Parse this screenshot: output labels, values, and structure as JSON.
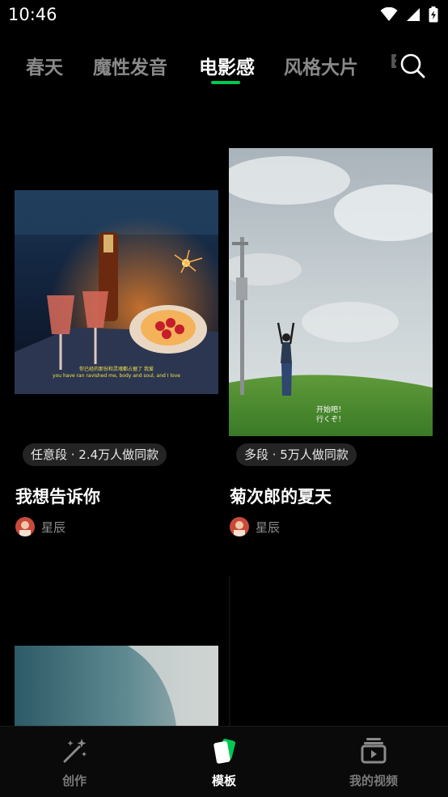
{
  "status": {
    "time": "10:46"
  },
  "tabs": [
    {
      "label": "春天"
    },
    {
      "label": "魔性发音"
    },
    {
      "label": "电影感"
    },
    {
      "label": "风格大片"
    }
  ],
  "active_tab": "电影感",
  "cards": [
    {
      "badge": "任意段 · 2.4万人做同款",
      "title": "我想告诉你",
      "author": "星辰",
      "caption_line1": "你已经的那份和灵魂都占据了 我爱",
      "caption_line2": "you have ran ravished me, body and soul, and I love"
    },
    {
      "badge": "多段 · 5万人做同款",
      "title": "菊次郎的夏天",
      "author": "星辰",
      "caption_line1": "开始吧！",
      "caption_line2": "行くぞ！"
    }
  ],
  "nav": {
    "items": [
      {
        "label": "创作",
        "icon": "magic-wand-icon"
      },
      {
        "label": "模板",
        "icon": "template-icon"
      },
      {
        "label": "我的视频",
        "icon": "my-videos-icon"
      }
    ],
    "active": "模板"
  },
  "colors": {
    "accent": "#00c853",
    "background": "#000000"
  }
}
